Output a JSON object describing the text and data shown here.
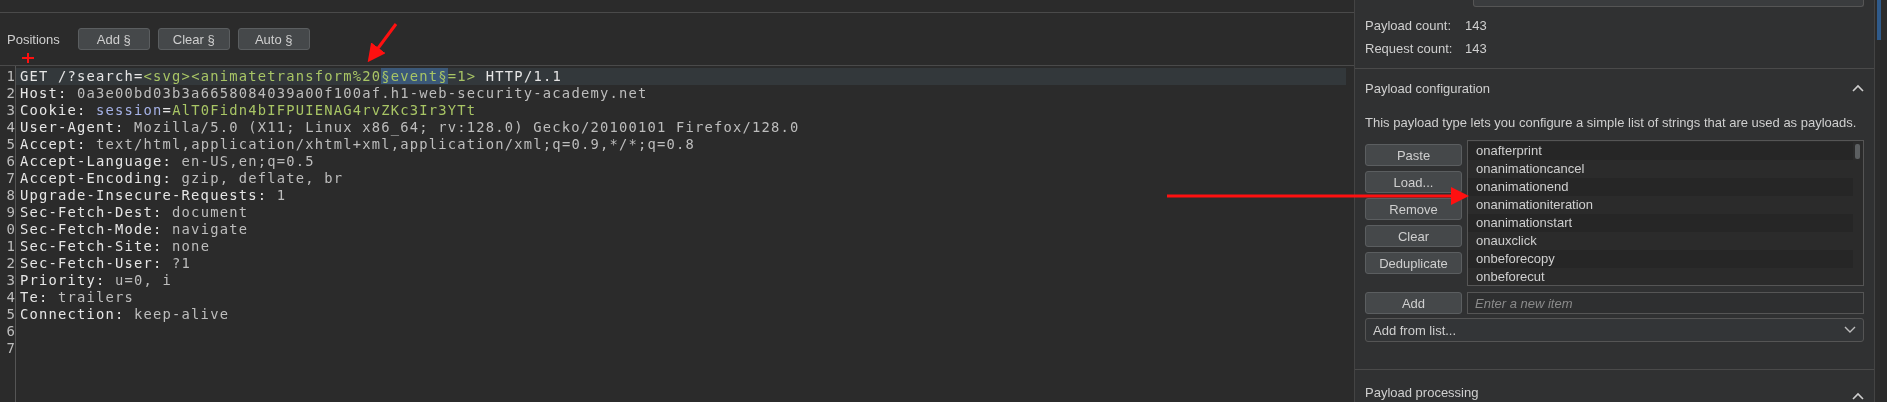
{
  "toolbar": {
    "label": "Positions",
    "buttons": [
      "Add §",
      "Clear §",
      "Auto §"
    ]
  },
  "editor": {
    "lines": [
      {
        "number": "1",
        "selected": true,
        "segments": [
          {
            "kind": "plain",
            "text": "GET /?search="
          },
          {
            "kind": "param",
            "text": "<svg><animatetransform%20"
          },
          {
            "kind": "marker",
            "text": "§event§"
          },
          {
            "kind": "param",
            "text": "=1>"
          },
          {
            "kind": "plain",
            "text": " HTTP/1.1"
          }
        ]
      },
      {
        "number": "2",
        "selected": false,
        "segments": [
          {
            "kind": "name",
            "text": "Host: "
          },
          {
            "kind": "value",
            "text": "0a3e00bd03b3a6658084039a00f100af.h1-web-security-academy.net"
          }
        ]
      },
      {
        "number": "3",
        "selected": false,
        "segments": [
          {
            "kind": "name",
            "text": "Cookie: "
          },
          {
            "kind": "cookie",
            "text": "session"
          },
          {
            "kind": "name",
            "text": "="
          },
          {
            "kind": "param",
            "text": "AlT0Fidn4bIFPUIENAG4rvZKc3Ir3YTt"
          }
        ]
      },
      {
        "number": "4",
        "selected": false,
        "segments": [
          {
            "kind": "name",
            "text": "User-Agent: "
          },
          {
            "kind": "value",
            "text": "Mozilla/5.0 (X11; Linux x86_64; rv:128.0) Gecko/20100101 Firefox/128.0"
          }
        ]
      },
      {
        "number": "5",
        "selected": false,
        "segments": [
          {
            "kind": "name",
            "text": "Accept: "
          },
          {
            "kind": "value",
            "text": "text/html,application/xhtml+xml,application/xml;q=0.9,*/*;q=0.8"
          }
        ]
      },
      {
        "number": "6",
        "selected": false,
        "segments": [
          {
            "kind": "name",
            "text": "Accept-Language: "
          },
          {
            "kind": "value",
            "text": "en-US,en;q=0.5"
          }
        ]
      },
      {
        "number": "7",
        "selected": false,
        "segments": [
          {
            "kind": "name",
            "text": "Accept-Encoding: "
          },
          {
            "kind": "value",
            "text": "gzip, deflate, br"
          }
        ]
      },
      {
        "number": "8",
        "selected": false,
        "segments": [
          {
            "kind": "name",
            "text": "Upgrade-Insecure-Requests: "
          },
          {
            "kind": "value",
            "text": "1"
          }
        ]
      },
      {
        "number": "9",
        "selected": false,
        "segments": [
          {
            "kind": "name",
            "text": "Sec-Fetch-Dest: "
          },
          {
            "kind": "value",
            "text": "document"
          }
        ]
      },
      {
        "number": "0",
        "selected": false,
        "segments": [
          {
            "kind": "name",
            "text": "Sec-Fetch-Mode: "
          },
          {
            "kind": "value",
            "text": "navigate"
          }
        ]
      },
      {
        "number": "1",
        "selected": false,
        "segments": [
          {
            "kind": "name",
            "text": "Sec-Fetch-Site: "
          },
          {
            "kind": "value",
            "text": "none"
          }
        ]
      },
      {
        "number": "2",
        "selected": false,
        "segments": [
          {
            "kind": "name",
            "text": "Sec-Fetch-User: "
          },
          {
            "kind": "value",
            "text": "?1"
          }
        ]
      },
      {
        "number": "3",
        "selected": false,
        "segments": [
          {
            "kind": "name",
            "text": "Priority: "
          },
          {
            "kind": "value",
            "text": "u=0, i"
          }
        ]
      },
      {
        "number": "4",
        "selected": false,
        "segments": [
          {
            "kind": "name",
            "text": "Te: "
          },
          {
            "kind": "value",
            "text": "trailers"
          }
        ]
      },
      {
        "number": "5",
        "selected": false,
        "segments": [
          {
            "kind": "name",
            "text": "Connection: "
          },
          {
            "kind": "value",
            "text": "keep-alive"
          }
        ]
      },
      {
        "number": "6",
        "selected": false
      },
      {
        "number": "7",
        "selected": false
      }
    ]
  },
  "counts": [
    {
      "label": "Payload count:",
      "value": "143"
    },
    {
      "label": "Request count:",
      "value": "143"
    }
  ],
  "payload_configuration": {
    "title": "Payload configuration",
    "expanded": true,
    "description": "This payload type lets you configure a simple list of strings that are used as payloads.",
    "buttons": [
      "Paste",
      "Load...",
      "Remove",
      "Clear",
      "Deduplicate"
    ],
    "items": [
      "onafterprint",
      "onanimationcancel",
      "onanimationend",
      "onanimationiteration",
      "onanimationstart",
      "onauxclick",
      "onbeforecopy",
      "onbeforecut"
    ],
    "add_button": "Add",
    "new_item": {
      "placeholder": "Enter a new item"
    },
    "add_from_list": "Add from list..."
  },
  "payload_processing": {
    "title": "Payload processing",
    "expanded": true
  }
}
